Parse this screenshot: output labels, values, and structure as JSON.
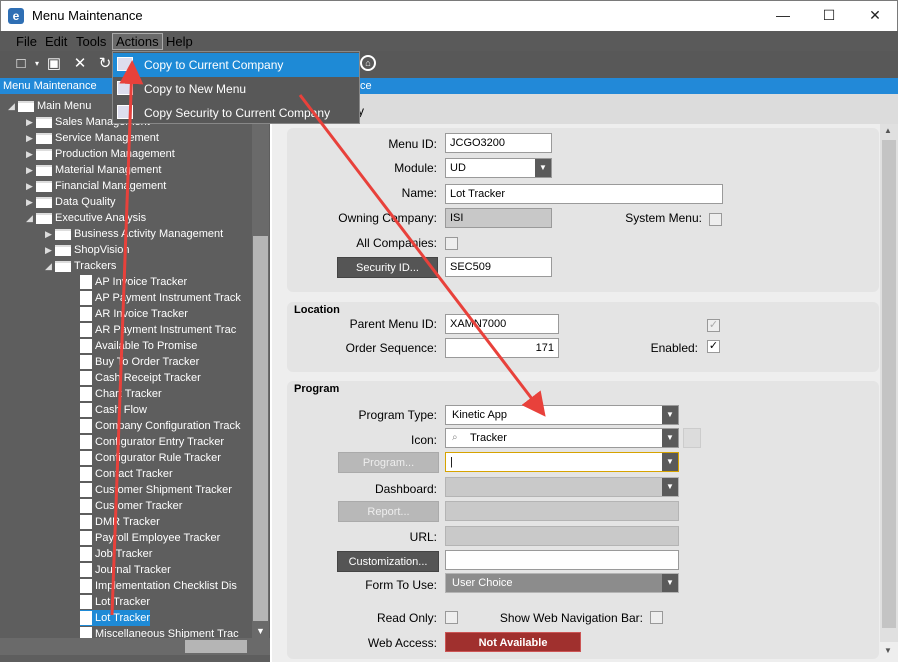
{
  "window": {
    "title": "Menu Maintenance",
    "app_letter": "e",
    "minimize": "—",
    "maximize": "☐",
    "close": "✕"
  },
  "menubar": [
    "File",
    "Edit",
    "Tools",
    "Actions",
    "Help"
  ],
  "actions_menu": {
    "items": [
      "Copy to Current Company",
      "Copy to New Menu",
      "Copy Security to Current Company"
    ]
  },
  "left_panel": {
    "header": "Menu Maintenance",
    "tree": {
      "root": "Main Menu",
      "top_folders": [
        "Sales Management",
        "Service Management",
        "Production Management",
        "Material Management",
        "Financial Management",
        "Data Quality",
        "Executive Analysis"
      ],
      "exec_children": [
        "Business Activity Management",
        "ShopVision",
        "Trackers"
      ],
      "trackers": [
        "AP Invoice Tracker",
        "AP Payment Instrument Track",
        "AR Invoice Tracker",
        "AR Payment Instrument Trac",
        "Available To Promise",
        "Buy To Order Tracker",
        "Cash Receipt Tracker",
        "Chart Tracker",
        "Cash Flow",
        "Company Configuration Track",
        "Configurator Entry Tracker",
        "Configurator Rule Tracker",
        "Contact Tracker",
        "Customer Shipment Tracker",
        "Customer Tracker",
        "DMR Tracker",
        "Payroll Employee Tracker",
        "Job Tracker",
        "Journal Tracker",
        "Implementation Checklist Dis",
        "Lot Tracker",
        "Lot Tracker",
        "Miscellaneous Shipment Trac"
      ]
    }
  },
  "right_panel": {
    "header": "ce",
    "tab_stub": "y",
    "menu": {
      "menu_id_label": "Menu ID:",
      "menu_id": "JCGO3200",
      "module_label": "Module:",
      "module": "UD",
      "name_label": "Name:",
      "name": "Lot Tracker",
      "owning_label": "Owning Company:",
      "owning": "ISI",
      "system_menu_label": "System Menu:",
      "all_companies_label": "All Companies:",
      "security_btn": "Security ID...",
      "security_id": "SEC509"
    },
    "location": {
      "title": "Location",
      "parent_label": "Parent Menu ID:",
      "parent": "XAMN7000",
      "order_label": "Order Sequence:",
      "order": "171",
      "enabled_label": "Enabled:"
    },
    "program": {
      "title": "Program",
      "type_label": "Program Type:",
      "type": "Kinetic App",
      "icon_label": "Icon:",
      "icon": "Tracker",
      "program_btn": "Program...",
      "program_value": "|",
      "dashboard_label": "Dashboard:",
      "report_btn": "Report...",
      "url_label": "URL:",
      "custom_btn": "Customization...",
      "form_label": "Form To Use:",
      "form": "User Choice",
      "readonly_label": "Read Only:",
      "webnav_label": "Show Web Navigation Bar:",
      "webaccess_label": "Web Access:",
      "webaccess": "Not Available"
    }
  },
  "colors": {
    "accent": "#2289d8",
    "dark": "#5e5e5e",
    "arrow": "#e8413b",
    "notavail": "#a0302e"
  }
}
